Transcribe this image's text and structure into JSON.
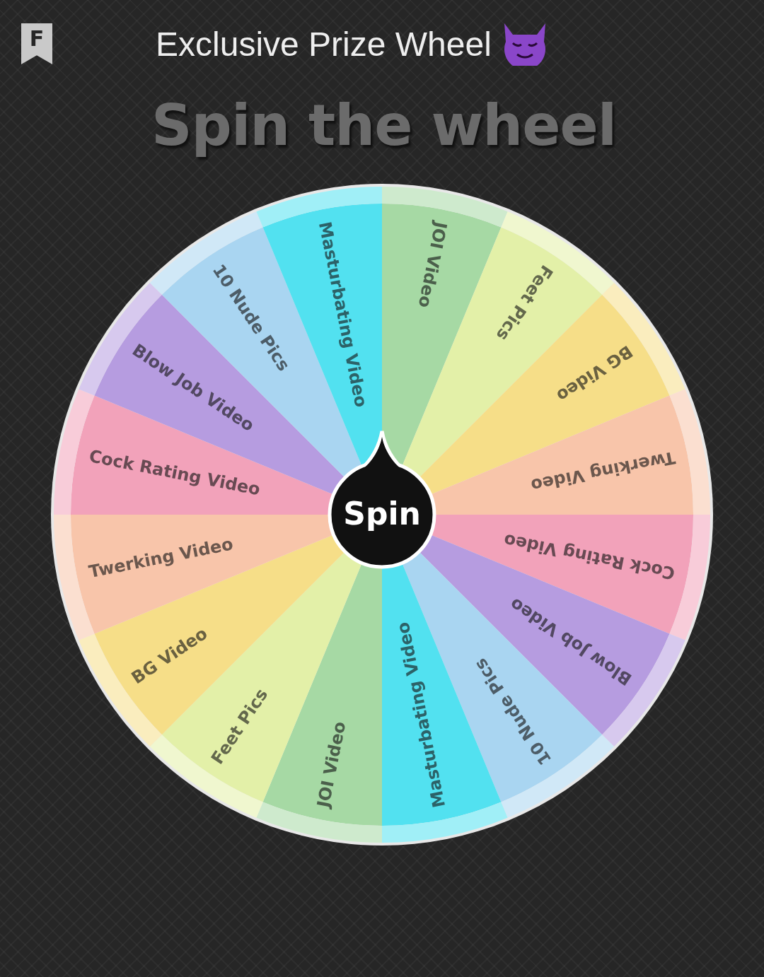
{
  "app_icon": {
    "label": "F"
  },
  "title": "Exclusive Prize Wheel",
  "heading": "Spin the wheel",
  "wheel": {
    "segments": [
      {
        "label": "JOI Video",
        "color": "#a6d9a4"
      },
      {
        "label": "Feet Pics",
        "color": "#e3f0a8"
      },
      {
        "label": "BG Video",
        "color": "#f6de88"
      },
      {
        "label": "Twerking Video",
        "color": "#f8c5aa"
      },
      {
        "label": "Cock Rating Video",
        "color": "#f2a2ba"
      },
      {
        "label": "Blow Job Video",
        "color": "#b69ce0"
      },
      {
        "label": "10 Nude Pics",
        "color": "#a9d5f1"
      },
      {
        "label": "Masturbating Video",
        "color": "#52e1f0"
      },
      {
        "label": "JOI Video",
        "color": "#a6d9a4"
      },
      {
        "label": "Feet Pics",
        "color": "#e3f0a8"
      },
      {
        "label": "BG Video",
        "color": "#f6de88"
      },
      {
        "label": "Twerking Video",
        "color": "#f8c5aa"
      },
      {
        "label": "Cock Rating Video",
        "color": "#f2a2ba"
      },
      {
        "label": "Blow Job Video",
        "color": "#b69ce0"
      },
      {
        "label": "10 Nude Pics",
        "color": "#a9d5f1"
      },
      {
        "label": "Masturbating Video",
        "color": "#52e1f0"
      }
    ],
    "spin_button": "Spin"
  }
}
